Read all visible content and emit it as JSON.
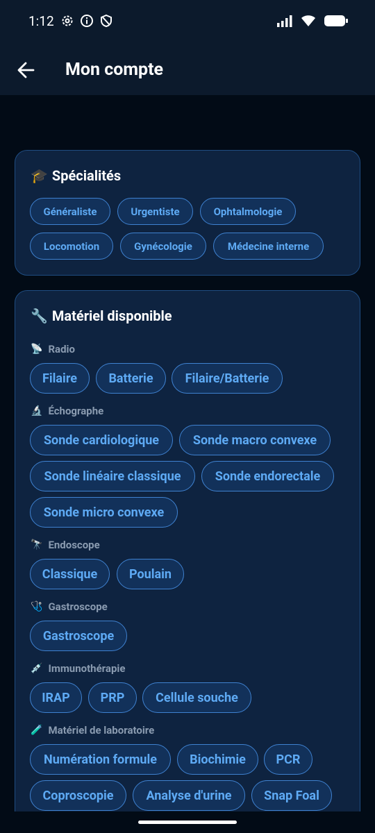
{
  "status": {
    "time": "1:12"
  },
  "header": {
    "title": "Mon compte"
  },
  "specialites": {
    "title": "Spécialités",
    "icon": "🎓",
    "chips": [
      "Généraliste",
      "Urgentiste",
      "Ophtalmologie",
      "Locomotion",
      "Gynécologie",
      "Médecine interne"
    ]
  },
  "materiel": {
    "title": "Matériel disponible",
    "icon": "🔧",
    "groups": [
      {
        "label": "Radio",
        "icon": "📡",
        "chips": [
          "Filaire",
          "Batterie",
          "Filaire/Batterie"
        ]
      },
      {
        "label": "Échographe",
        "icon": "🔬",
        "chips": [
          "Sonde cardiologique",
          "Sonde macro convexe",
          "Sonde linéaire classique",
          "Sonde endorectale",
          "Sonde micro convexe"
        ]
      },
      {
        "label": "Endoscope",
        "icon": "🔭",
        "chips": [
          "Classique",
          "Poulain"
        ]
      },
      {
        "label": "Gastroscope",
        "icon": "🩺",
        "chips": [
          "Gastroscope"
        ]
      },
      {
        "label": "Immunothérapie",
        "icon": "💉",
        "chips": [
          "IRAP",
          "PRP",
          "Cellule souche"
        ]
      },
      {
        "label": "Matériel de laboratoire",
        "icon": "🧪",
        "chips": [
          "Numération formule",
          "Biochimie",
          "PCR",
          "Coproscopie",
          "Analyse d'urine",
          "Snap Foal"
        ]
      }
    ]
  },
  "colors": {
    "background": "#020b16",
    "card": "#0e2340",
    "chip_border": "#3f82d1",
    "chip_text": "#5eaaf4"
  }
}
